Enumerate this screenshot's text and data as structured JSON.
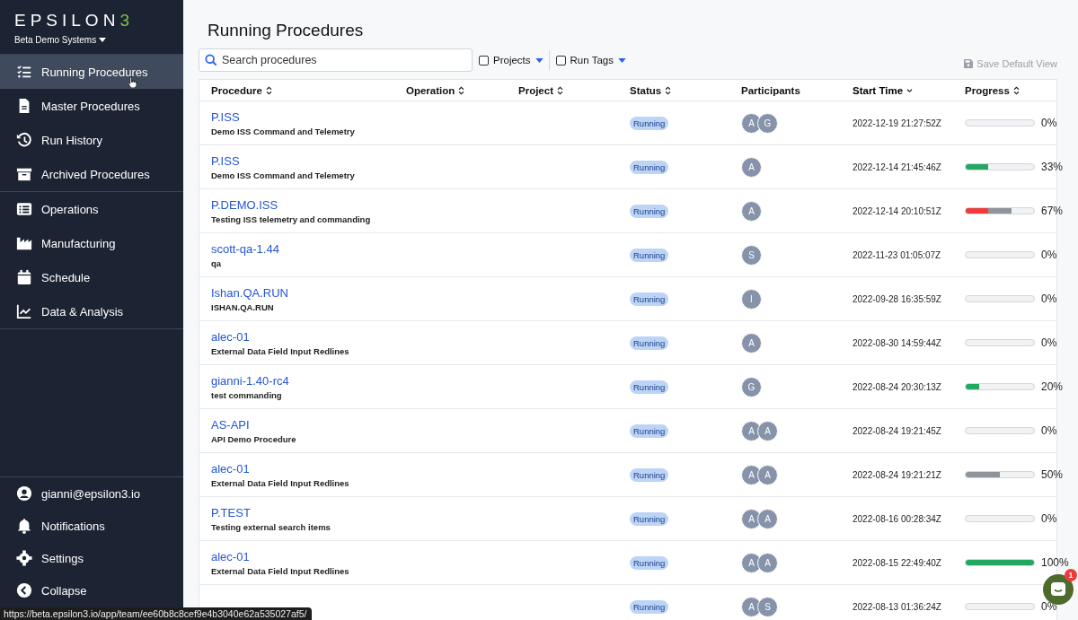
{
  "sidebar": {
    "logo": {
      "letters": "EPSILON",
      "mark": "3"
    },
    "workspace": "Beta Demo Systems",
    "groups": [
      [
        {
          "label": "Running Procedures",
          "selected": true
        },
        {
          "label": "Master Procedures",
          "selected": false
        },
        {
          "label": "Run History",
          "selected": false
        },
        {
          "label": "Archived Procedures",
          "selected": false
        }
      ],
      [
        {
          "label": "Operations",
          "selected": false
        },
        {
          "label": "Manufacturing",
          "selected": false
        },
        {
          "label": "Schedule",
          "selected": false
        },
        {
          "label": "Data & Analysis",
          "selected": false
        }
      ]
    ],
    "bottom": [
      {
        "label": "gianni@epsilon3.io"
      },
      {
        "label": "Notifications"
      },
      {
        "label": "Settings"
      },
      {
        "label": "Collapse"
      }
    ]
  },
  "page": {
    "title": "Running Procedures"
  },
  "toolbar": {
    "search": {
      "placeholder": "Search procedures"
    },
    "filters": [
      {
        "label": "Projects",
        "checked": false
      },
      {
        "label": "Run Tags",
        "checked": false
      }
    ],
    "save": {
      "label": "Save Default View",
      "disabled": true
    }
  },
  "table": {
    "columns": [
      {
        "label": "Procedure",
        "sortable": true,
        "selected": false
      },
      {
        "label": "Operation",
        "sortable": true,
        "selected": false
      },
      {
        "label": "Project",
        "sortable": true,
        "selected": false
      },
      {
        "label": "Status",
        "sortable": true,
        "selected": false
      },
      {
        "label": "Participants",
        "sortable": false,
        "selected": false
      },
      {
        "label": "Start Time",
        "sortable": true,
        "selected": true
      },
      {
        "label": "Progress",
        "sortable": true,
        "selected": false
      }
    ],
    "rows": [
      {
        "name": "P.ISS",
        "description": "Demo ISS Command and Telemetry",
        "status": "Running",
        "participants": [
          "A",
          "G"
        ],
        "start": "2022-12-19 21:27:52Z",
        "progress": [
          {
            "level": 0
          }
        ],
        "percent": "0%"
      },
      {
        "name": "P.ISS",
        "description": "Demo ISS Command and Telemetry",
        "status": "Running",
        "participants": [
          "A"
        ],
        "start": "2022-12-14 21:45:46Z",
        "progress": [
          {
            "level": 0.33,
            "color": "#22a861"
          }
        ],
        "percent": "33%"
      },
      {
        "name": "P.DEMO.ISS",
        "description": "Testing ISS telemetry and commanding",
        "status": "Running",
        "participants": [
          "A"
        ],
        "start": "2022-12-14 20:10:51Z",
        "progress": [
          {
            "level": 0.33,
            "color": "#ef3b3b"
          },
          {
            "level": 0.67,
            "color": "#8e939c"
          }
        ],
        "percent": "67%"
      },
      {
        "name": "scott-qa-1.44",
        "description": "qa",
        "status": "Running",
        "participants": [
          "S"
        ],
        "start": "2022-11-23 01:05:07Z",
        "progress": [
          {
            "level": 0
          }
        ],
        "percent": "0%"
      },
      {
        "name": "Ishan.QA.RUN",
        "description": "ISHAN.QA.RUN",
        "status": "Running",
        "participants": [
          "I"
        ],
        "start": "2022-09-28 16:35:59Z",
        "progress": [
          {
            "level": 0
          }
        ],
        "percent": "0%"
      },
      {
        "name": "alec-01",
        "description": "External Data Field Input Redlines",
        "status": "Running",
        "participants": [
          "A"
        ],
        "start": "2022-08-30 14:59:44Z",
        "progress": [
          {
            "level": 0
          }
        ],
        "percent": "0%"
      },
      {
        "name": "gianni-1.40-rc4",
        "description": "test commanding",
        "status": "Running",
        "participants": [
          "G"
        ],
        "start": "2022-08-24 20:30:13Z",
        "progress": [
          {
            "level": 0.2,
            "color": "#22a861"
          }
        ],
        "percent": "20%"
      },
      {
        "name": "AS-API",
        "description": "API Demo Procedure",
        "status": "Running",
        "participants": [
          "A",
          "A"
        ],
        "start": "2022-08-24 19:21:45Z",
        "progress": [
          {
            "level": 0
          }
        ],
        "percent": "0%"
      },
      {
        "name": "alec-01",
        "description": "External Data Field Input Redlines",
        "status": "Running",
        "participants": [
          "A",
          "A"
        ],
        "start": "2022-08-24 19:21:21Z",
        "progress": [
          {
            "level": 0.5,
            "color": "#8e939c"
          }
        ],
        "percent": "50%"
      },
      {
        "name": "P.TEST",
        "description": "Testing external search items",
        "status": "Running",
        "participants": [
          "A",
          "A"
        ],
        "start": "2022-08-16 00:28:34Z",
        "progress": [
          {
            "level": 0
          }
        ],
        "percent": "0%"
      },
      {
        "name": "alec-01",
        "description": "External Data Field Input Redlines",
        "status": "Running",
        "participants": [
          "A",
          "A"
        ],
        "start": "2022-08-15 22:49:40Z",
        "progress": [
          {
            "level": 1,
            "color": "#22a861"
          }
        ],
        "percent": "100%"
      },
      {
        "status": "Running",
        "participants": [
          "A",
          "S"
        ],
        "start": "2022-08-13 01:36:24Z",
        "progress": [
          {
            "level": 0
          }
        ],
        "percent": "0%"
      }
    ]
  },
  "link_preview": "https://beta.epsilon3.io/app/team/ee60b8c8cef9e4b3040e62a535027af5/",
  "chat": {
    "badge": "1"
  }
}
